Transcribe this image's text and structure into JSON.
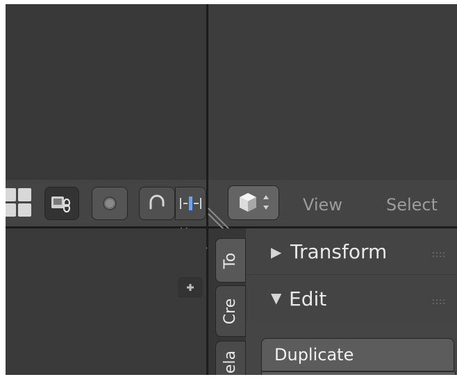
{
  "header": {
    "menu": [
      {
        "label": "View"
      },
      {
        "label": "Select"
      }
    ]
  },
  "icons": {
    "layout": "layout-grid-icon",
    "linked": "linked-data-icon",
    "record": "record-icon",
    "snap": "snap-magnet-icon",
    "snap_mode": "snap-increment-icon",
    "object_mode": "object-mode-cube-icon",
    "add": "plus-icon"
  },
  "tool_shelf": {
    "tabs": [
      {
        "label": "To"
      },
      {
        "label": "Cre"
      },
      {
        "label": "ela"
      }
    ],
    "sections": [
      {
        "title": "Transform",
        "expanded": false
      },
      {
        "title": "Edit",
        "expanded": true
      }
    ],
    "buttons": [
      {
        "label": "Duplicate"
      }
    ]
  },
  "colors": {
    "background": "#393939",
    "header": "#444444",
    "accent_blue": "#6fa3e8"
  }
}
